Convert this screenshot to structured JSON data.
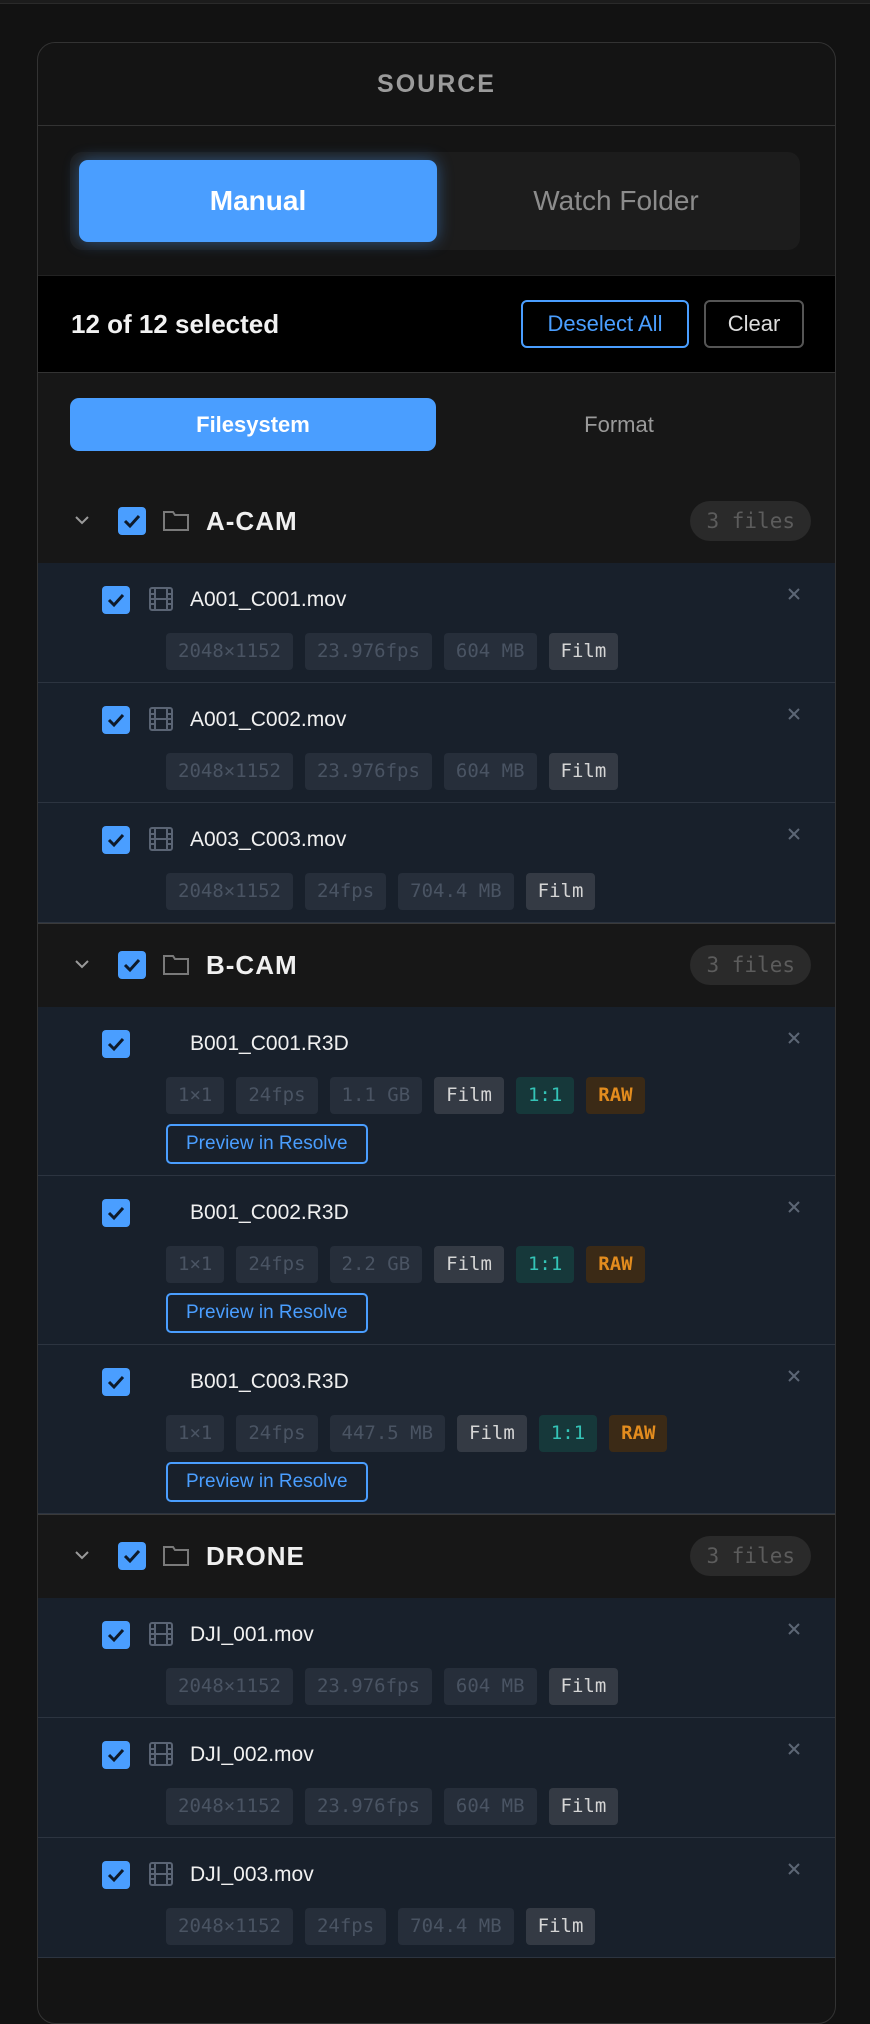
{
  "header": {
    "title": "SOURCE"
  },
  "mode": {
    "manual": "Manual",
    "watch_folder": "Watch Folder"
  },
  "selection": {
    "status": "12 of 12 selected",
    "deselect_all": "Deselect All",
    "clear": "Clear"
  },
  "view_tabs": {
    "filesystem": "Filesystem",
    "format": "Format"
  },
  "groups": [
    {
      "name": "A-CAM",
      "count": "3 files",
      "files": [
        {
          "name": "A001_C001.mov",
          "resolution": "2048×1152",
          "fps": "23.976fps",
          "size": "604 MB",
          "type": "Film"
        },
        {
          "name": "A001_C002.mov",
          "resolution": "2048×1152",
          "fps": "23.976fps",
          "size": "604 MB",
          "type": "Film"
        },
        {
          "name": "A003_C003.mov",
          "resolution": "2048×1152",
          "fps": "24fps",
          "size": "704.4 MB",
          "type": "Film"
        }
      ]
    },
    {
      "name": "B-CAM",
      "count": "3 files",
      "files": [
        {
          "name": "B001_C001.R3D",
          "resolution": "1×1",
          "fps": "24fps",
          "size": "1.1 GB",
          "type": "Film",
          "ratio": "1:1",
          "raw": "RAW",
          "preview": "Preview in Resolve"
        },
        {
          "name": "B001_C002.R3D",
          "resolution": "1×1",
          "fps": "24fps",
          "size": "2.2 GB",
          "type": "Film",
          "ratio": "1:1",
          "raw": "RAW",
          "preview": "Preview in Resolve"
        },
        {
          "name": "B001_C003.R3D",
          "resolution": "1×1",
          "fps": "24fps",
          "size": "447.5 MB",
          "type": "Film",
          "ratio": "1:1",
          "raw": "RAW",
          "preview": "Preview in Resolve"
        }
      ]
    },
    {
      "name": "DRONE",
      "count": "3 files",
      "files": [
        {
          "name": "DJI_001.mov",
          "resolution": "2048×1152",
          "fps": "23.976fps",
          "size": "604 MB",
          "type": "Film"
        },
        {
          "name": "DJI_002.mov",
          "resolution": "2048×1152",
          "fps": "23.976fps",
          "size": "604 MB",
          "type": "Film"
        },
        {
          "name": "DJI_003.mov",
          "resolution": "2048×1152",
          "fps": "24fps",
          "size": "704.4 MB",
          "type": "Film"
        }
      ]
    }
  ],
  "colors": {
    "accent": "#4a9eff",
    "raw": "#e38c1e",
    "ratio": "#34c4b7",
    "file_bg": "#18202b"
  },
  "icons": {
    "chevron": "chevron-down-icon",
    "checkbox": "checkbox-checked-icon",
    "folder": "folder-icon",
    "film": "film-icon",
    "close": "close-icon"
  }
}
